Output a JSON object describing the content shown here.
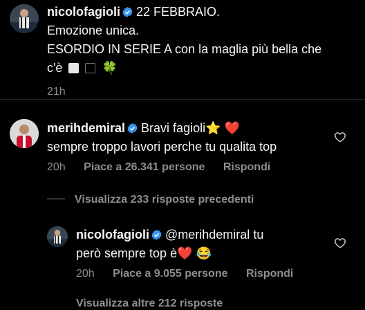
{
  "post": {
    "username": "nicolofagioli",
    "line1": "22 FEBBRAIO.",
    "line2": "Emozione unica.",
    "line3": "ESORDIO IN SERIE A con la maglia più bella che",
    "line4": "c'è",
    "clover": "🍀",
    "time": "21h"
  },
  "comment1": {
    "username": "merihdemiral",
    "text1": "Bravi fagioli",
    "star": "⭐",
    "redheart": "❤️",
    "text2": "sempre troppo lavori perche tu qualita top",
    "time": "20h",
    "likes": "Piace a 26.341 persone",
    "reply": "Rispondi"
  },
  "view_replies": "Visualizza 233 risposte precedenti",
  "reply1": {
    "username": "nicolofagioli",
    "mention": "@merihdemiral",
    "text1": "tu",
    "text2": "però sempre top è",
    "redheart": "❤️",
    "laugh": "😂",
    "time": "20h",
    "likes": "Piace a 9.055 persone",
    "reply": "Rispondi"
  },
  "cut_text": "Visualizza altre 212 risposte",
  "colors": {
    "bg": "#000000",
    "text": "#f5f5f5",
    "muted": "#8e8e8e",
    "verified": "#3897f0"
  }
}
